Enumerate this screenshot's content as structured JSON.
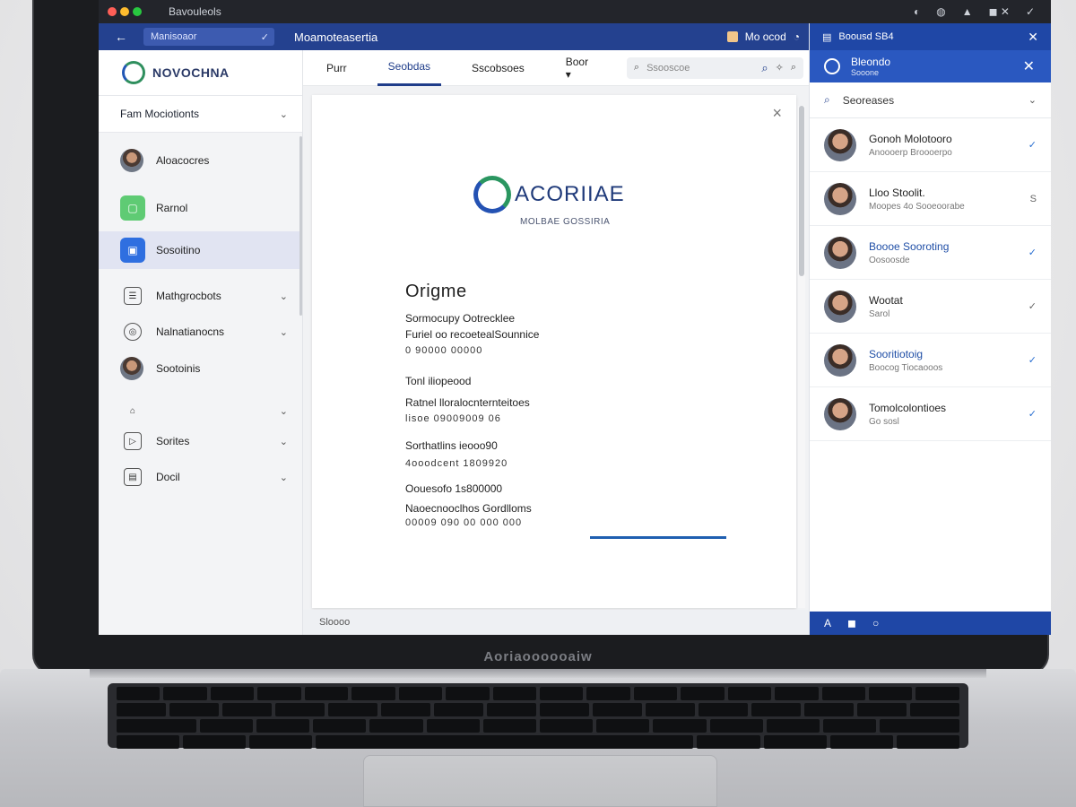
{
  "window": {
    "title": "Bavouleols",
    "menubar_right": [
      "◐",
      "◍",
      "▲",
      "◼ ✕",
      "✓"
    ]
  },
  "header": {
    "back_label": "←",
    "address": "Manisoaor",
    "address_icon": "✓",
    "title": "Moamoteasertia",
    "right_text": "Mo ocod",
    "right_icon": "◔"
  },
  "sidebar": {
    "logo_text": "NOVOCHNA",
    "team_label": "Fam Mociotionts",
    "items": [
      {
        "label": "Aloacocres",
        "type": "avatar"
      },
      {
        "label": "Rarnol",
        "type": "green"
      },
      {
        "label": "Sosoitino",
        "type": "blue",
        "active": true
      },
      {
        "label": "Mathgrocbots",
        "type": "box",
        "chevron": true
      },
      {
        "label": "Nalnatianocns",
        "type": "circle",
        "chevron": true
      },
      {
        "label": "Sootoinis",
        "type": "avatar"
      },
      {
        "label": "",
        "type": "box",
        "chevron": true
      },
      {
        "label": "Sorites",
        "type": "box",
        "chevron": true
      },
      {
        "label": "Docil",
        "type": "box",
        "chevron": true
      }
    ]
  },
  "main": {
    "tabs": [
      {
        "label": "Purr",
        "active": false
      },
      {
        "label": "Seobdas",
        "active": true
      },
      {
        "label": "Sscobsoes",
        "active": false
      },
      {
        "label": "Boor ▾",
        "active": false
      }
    ],
    "search_placeholder": "Ssooscoe",
    "footer": "Sloooo"
  },
  "document": {
    "brand_name": "ACORIIAE",
    "brand_tagline": "MOLBAE GOSSIRIA",
    "heading": "Origme",
    "sections": [
      {
        "lines": [
          "Sormocupy Ootrecklee",
          "Furiel oo recoetealSounnice",
          "0 90000 00000"
        ]
      },
      {
        "lines": [
          "Tonl iliopeood",
          "Ratnel lloralocnternteitoes",
          "lisoe 09009009 06"
        ]
      },
      {
        "lines": [
          "Sorthatlins ieooo90",
          "4ooodcent 1809920"
        ]
      },
      {
        "lines": [
          "Oouesofo 1s800000",
          "Naoecnooclhos Gordlloms",
          "00009 090 00 000 000"
        ]
      }
    ],
    "progress": 1.0
  },
  "right_panel": {
    "top_label": "Boousd SB4",
    "title": "Bleondo",
    "subtitle": "Sooone",
    "search_label": "Seoreases",
    "contacts": [
      {
        "name": "Gonoh Molotooro",
        "status": "Anoooerp Broooerpo",
        "blue": false,
        "action": "✓"
      },
      {
        "name": "Lloo Stoolit.",
        "status": "Moopes 4o Sooeoorabe",
        "blue": false,
        "action": "S"
      },
      {
        "name": "Boooe Sooroting",
        "status": "Oosoosde",
        "blue": true,
        "action": "✓"
      },
      {
        "name": "Wootat",
        "status": "Sarol",
        "blue": false,
        "action": "✓"
      },
      {
        "name": "Sooritiotoig",
        "status": "Boocog Tiocaooos",
        "blue": true,
        "action": "✓"
      },
      {
        "name": "Tomolcolontioes",
        "status": "Go sosl",
        "blue": false,
        "action": "✓"
      }
    ],
    "footer_icons": [
      "A",
      "◼",
      "○"
    ]
  },
  "laptop_brand": "Aoriaoooooaiw",
  "colors": {
    "accent": "#24418f",
    "panel_blue": "#1f47a6",
    "active_tab": "#1f3d8a"
  }
}
